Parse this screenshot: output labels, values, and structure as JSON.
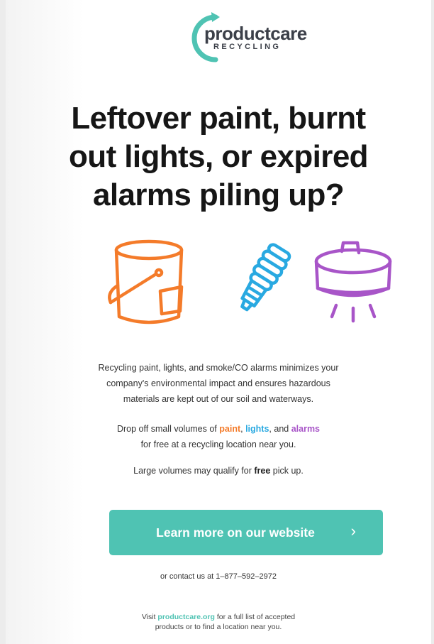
{
  "logo": {
    "word_a": "product",
    "word_b": "care",
    "sub": "RECYCLING",
    "colors": {
      "arc": "#4fc3b3",
      "text": "#3b3f48"
    }
  },
  "headline": {
    "line1": "Leftover paint, burnt",
    "line2": "out lights, or expired",
    "line3": "alarms piling up?"
  },
  "icons": [
    "paint-can-icon",
    "light-bulb-icon",
    "smoke-alarm-icon"
  ],
  "intro": {
    "line1": "Recycling paint, lights, and smoke/CO alarms minimizes your",
    "line2": "company's environmental impact and ensures hazardous",
    "line3": "materials are kept out of our soil and waterways."
  },
  "dropoff": {
    "pre": "Drop off small volumes of ",
    "paint": "paint",
    "sep1": ", ",
    "lights": "lights",
    "sep2": ", and ",
    "alarms": "alarms",
    "line2": "for free at a recycling location near you."
  },
  "pickup": {
    "pre": "Large volumes may qualify for ",
    "bold": "free",
    "post": " pick up."
  },
  "cta": {
    "label": "Learn more on our website",
    "chevron": "›"
  },
  "contact": "or contact us at 1–877–592–2972",
  "footer": {
    "pre": "Visit ",
    "link": "productcare.org",
    "post": " for a full list of accepted",
    "line2": "products or to find a location near you."
  },
  "colors": {
    "paint": "#f47b2a",
    "lights": "#29a9e1",
    "alarms": "#a855c8",
    "accent": "#4fc3b3"
  }
}
